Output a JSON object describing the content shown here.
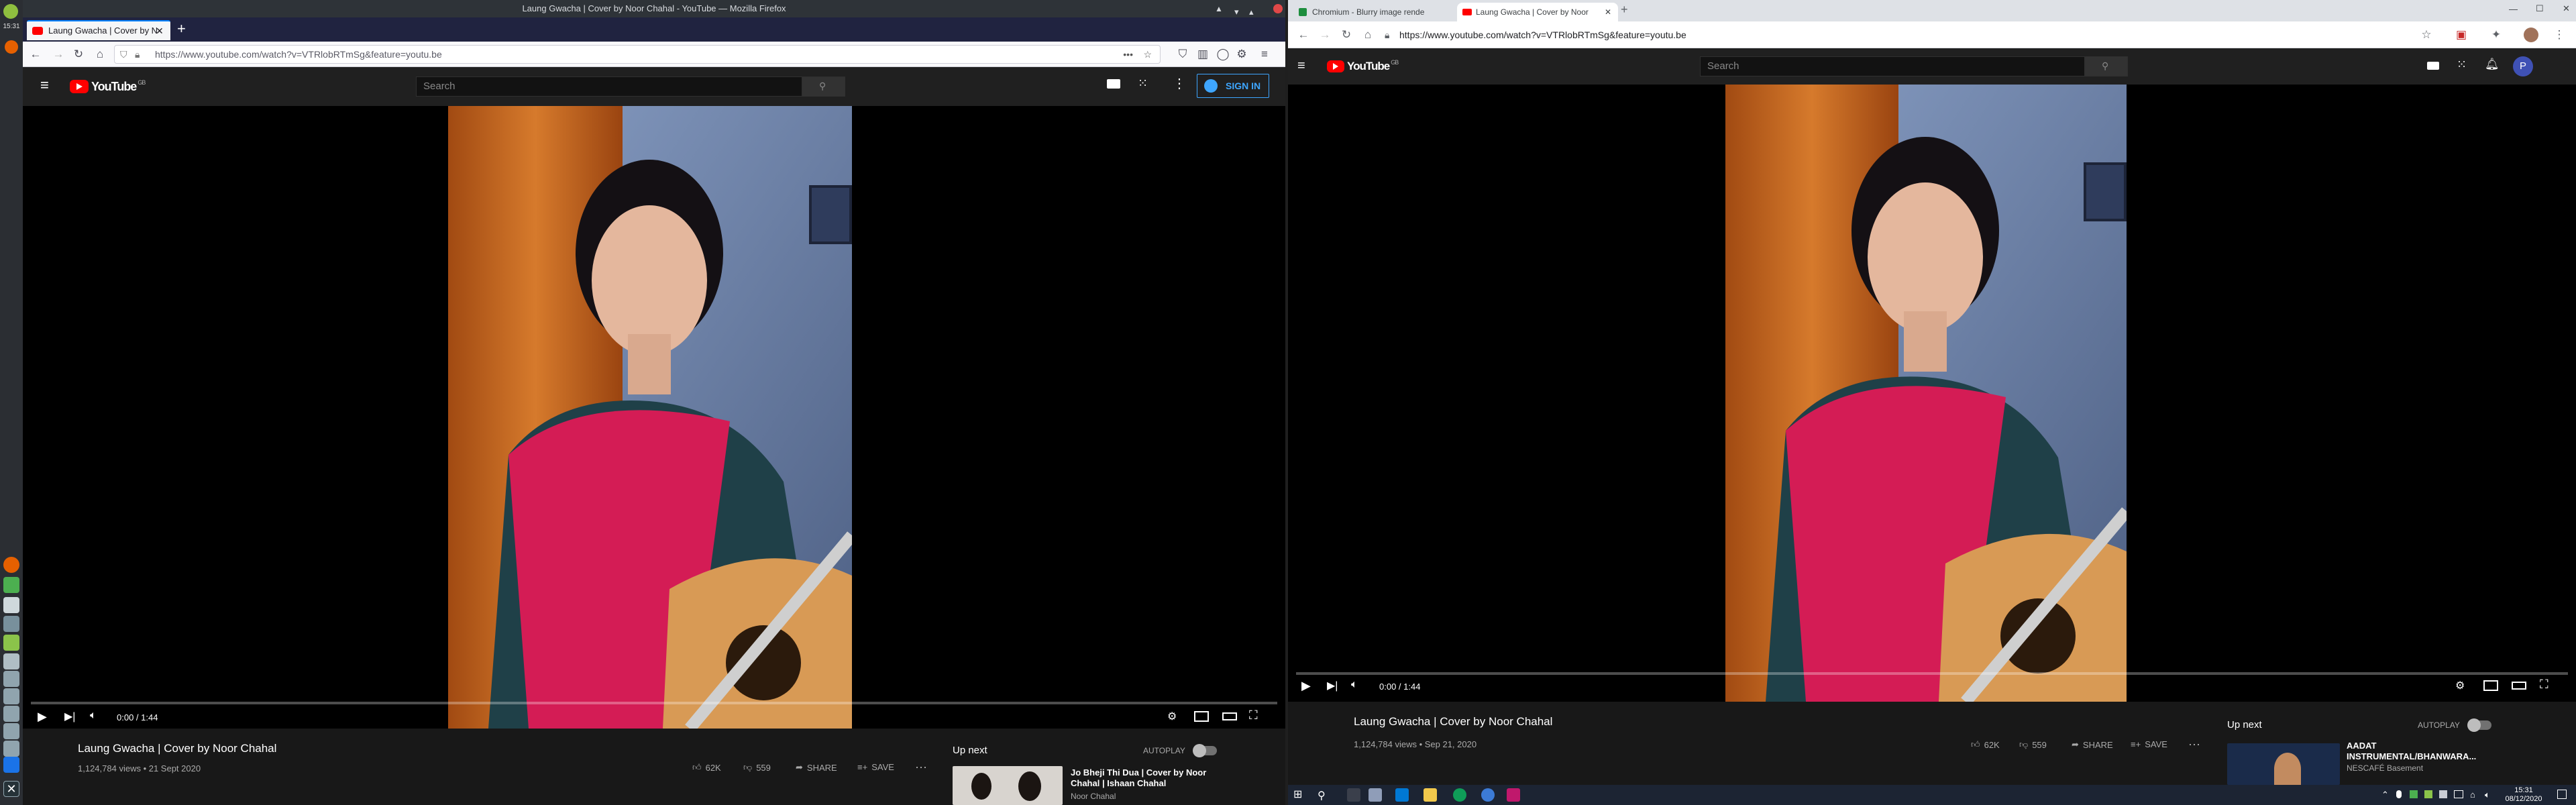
{
  "system": {
    "clock": "15:31",
    "win_clock_time": "15:31",
    "win_clock_date": "08/12/2020"
  },
  "firefox": {
    "window_title": "Laung Gwacha | Cover by Noor Chahal - YouTube — Mozilla Firefox",
    "tab_title": "Laung Gwacha | Cover by N",
    "url": "https://www.youtube.com/watch?v=VTRlobRTmSg&feature=youtu.be"
  },
  "chromium": {
    "tabs": [
      {
        "title": "Chromium - Blurry image rende"
      },
      {
        "title": "Laung Gwacha | Cover by Noor"
      }
    ],
    "url": "https://www.youtube.com/watch?v=VTRlobRTmSg&feature=youtu.be",
    "avatar_letter": "P"
  },
  "youtube": {
    "logo_text": "YouTube",
    "logo_region": "GB",
    "search_placeholder": "Search",
    "sign_in": "SIGN IN",
    "video_title": "Laung Gwacha | Cover by Noor Chahal",
    "time": "0:00 / 1:44",
    "autoplay": "AUTOPLAY",
    "up_next": "Up next",
    "share": "SHARE",
    "save": "SAVE",
    "left": {
      "views_date": "1,124,784 views • 21 Sept 2020",
      "likes": "62K",
      "dislikes": "559",
      "next_title_1": "Jo Bheji Thi Dua | Cover by Noor",
      "next_title_2": "Chahal | Ishaan Chahal",
      "next_channel": "Noor Chahal"
    },
    "right": {
      "views_date": "1,124,784 views • Sep 21, 2020",
      "likes": "62K",
      "dislikes": "559",
      "next_title_1": "AADAT",
      "next_title_2": "INSTRUMENTAL/BHANWARA...",
      "next_channel": "NESCAFÉ Basement"
    }
  },
  "colors": {
    "yt_red": "#ff0000",
    "sign_in_blue": "#3ea6ff",
    "dark_bg": "#181818",
    "header_bg": "#202020"
  }
}
